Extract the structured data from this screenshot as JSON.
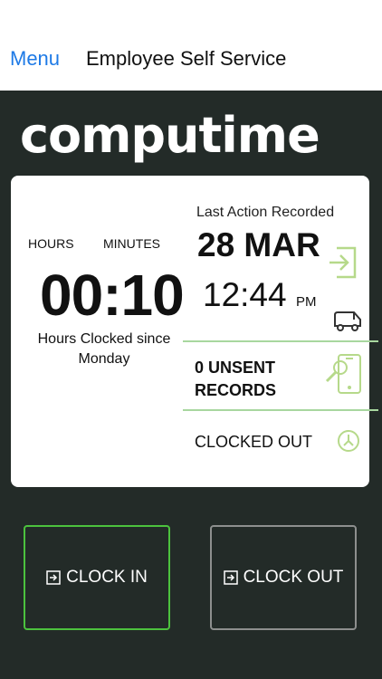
{
  "nav": {
    "menu_label": "Menu",
    "title": "Employee Self Service"
  },
  "brand": {
    "logo_text": "computime"
  },
  "summary": {
    "hours_label": "HOURS",
    "minutes_label": "MINUTES",
    "time_value": "00:10",
    "since_text": "Hours Clocked since Monday"
  },
  "last_action": {
    "label": "Last Action Recorded",
    "date": "28 MAR",
    "time": "12:44",
    "ampm": "PM"
  },
  "unsent": {
    "text_line1": "0 UNSENT",
    "text_line2": "RECORDS"
  },
  "status": {
    "text": "CLOCKED OUT"
  },
  "actions": {
    "clock_in_label": "CLOCK IN",
    "clock_out_label": "CLOCK OUT"
  },
  "colors": {
    "accent": "#1e7ae6",
    "green": "#4cc23e",
    "icon_green": "#b6d98a",
    "background": "#232b28"
  },
  "icons": {
    "login": "login-icon",
    "vehicle": "van-icon",
    "search_phone": "phone-search-icon",
    "clock": "clock-icon",
    "clock_in": "clock-in-icon",
    "clock_out": "clock-out-icon"
  }
}
